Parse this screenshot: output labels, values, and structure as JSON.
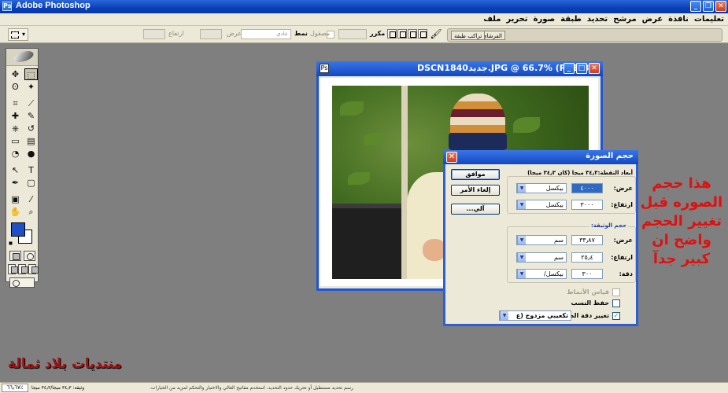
{
  "window": {
    "title": "Adobe Photoshop"
  },
  "menu": [
    "ملف",
    "تحرير",
    "صورة",
    "طبقة",
    "تحديد",
    "مرشح",
    "عرض",
    "نافذة",
    "تعليمات"
  ],
  "options_bar": {
    "feather_label": "تنعيم",
    "feather_value": "",
    "antialias_label": "مصقول",
    "style_label": "نمط",
    "style_value": "عادي",
    "width_label": "عرض",
    "height_label": "ارتفاع",
    "refine_label": "حد مكرر",
    "palette_tabs": [
      "تراكب طبقة",
      "الفرشاي"
    ]
  },
  "toolbox": {
    "tools": [
      "move",
      "marquee",
      "lasso",
      "magic-wand",
      "crop",
      "slice",
      "healing-brush",
      "brush",
      "clone-stamp",
      "history-brush",
      "eraser",
      "gradient",
      "blur",
      "dodge",
      "path-selection",
      "type",
      "pen",
      "shape",
      "notes",
      "eyedropper",
      "hand",
      "zoom"
    ],
    "tool_glyphs": [
      "✥",
      "⬚",
      "ʘ",
      "✦",
      "⌗",
      "⟋",
      "✚",
      "✎",
      "⎈",
      "↺",
      "▭",
      "▤",
      "◔",
      "●",
      "↖",
      "T",
      "✒",
      "▢",
      "▣",
      "⁄",
      "✋",
      "⌕"
    ],
    "foreground_color": "#1f4fc4",
    "background_color": "#ffffff"
  },
  "document": {
    "title": "DSCN1840جديد.JPG @ 66.7% (RGB/8)"
  },
  "image_size_dialog": {
    "title": "حجم الصورة",
    "pixel_dimensions": "أبعاد النقطة:٣٤٫٣ ميجا (كان ٣٤٫٣ ميجا)",
    "ok": "موافق",
    "cancel": "إلغاء الأمر",
    "auto": "آلي...",
    "pixel": {
      "width_label": "عرض:",
      "width_value": "٤٠٠٠",
      "width_unit": "بيكسل",
      "height_label": "ارتفاع:",
      "height_value": "٣٠٠٠",
      "height_unit": "بيكسل"
    },
    "document_size": {
      "label": "حجم الوثيقة:",
      "width_label": "عرض:",
      "width_value": "٣٣٫٨٧",
      "width_unit": "سم",
      "height_label": "ارتفاع:",
      "height_value": "٢٥٫٤",
      "height_unit": "سم",
      "resolution_label": "دقة:",
      "resolution_value": "٣٠٠",
      "resolution_unit": "بيكسل/"
    },
    "scale_styles": "قياس الأنماط",
    "constrain": "حفظ النسب",
    "resample": "تغيير دقة الصورة:",
    "resample_method": "تكعيبي مزدوج (ع"
  },
  "annotation": {
    "lines": [
      "هذا حجم",
      "الصوره قبل",
      "تغيير الحجم",
      "واضح ان",
      "كبير جدآ"
    ],
    "color": "#e01010"
  },
  "watermark": "منتديات بلاد ثمالة",
  "status": {
    "zoom": "٦٦٫٦٧٪",
    "doc_info": "وثيقة: ٣٤٫٣ ميجا/٣٤٫٣ ميجا",
    "hint": "رسم تحديد مستطيل أو تحريك حدود التحديد. استخدم مفاتيح العالي والاختيار والتحكم لمزيد من الخيارات."
  }
}
